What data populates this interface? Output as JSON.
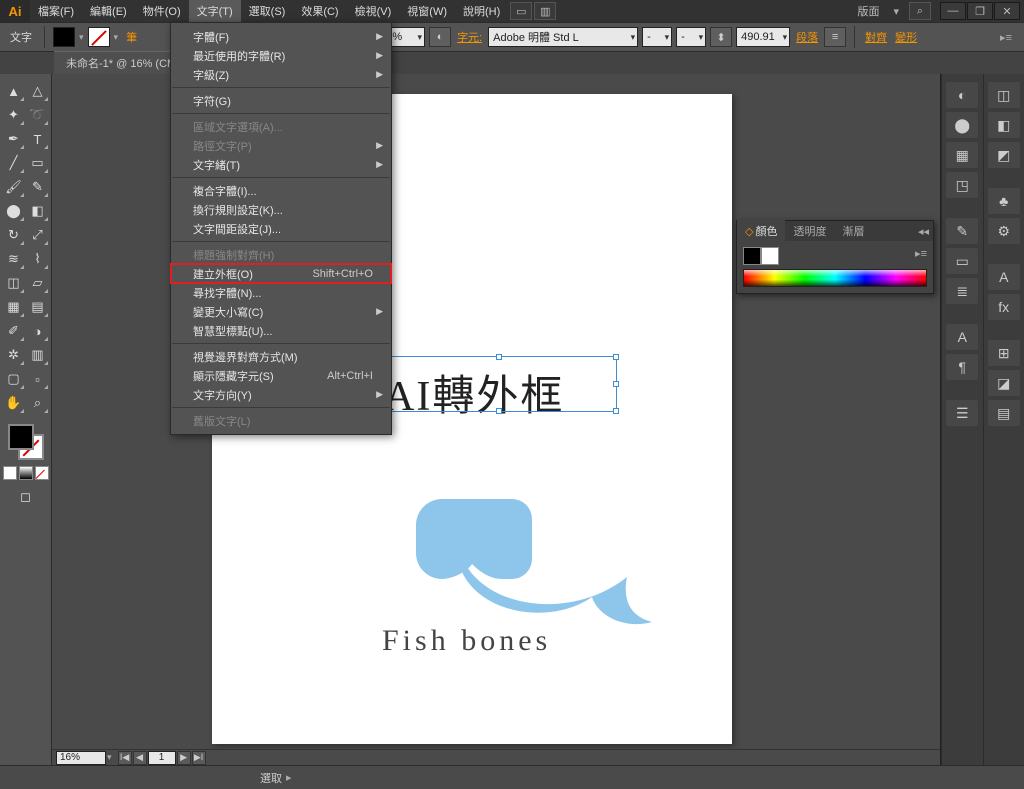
{
  "app": {
    "logo": "Ai"
  },
  "menubar": {
    "items": [
      {
        "label": "檔案(F)"
      },
      {
        "label": "編輯(E)"
      },
      {
        "label": "物件(O)"
      },
      {
        "label": "文字(T)",
        "active": true
      },
      {
        "label": "選取(S)"
      },
      {
        "label": "效果(C)"
      },
      {
        "label": "檢視(V)"
      },
      {
        "label": "視窗(W)"
      },
      {
        "label": "說明(H)"
      }
    ]
  },
  "titlebar_right": {
    "layout_label": "版面",
    "search_glyph": "⌕"
  },
  "window_buttons": {
    "min": "—",
    "max": "❐",
    "close": "✕"
  },
  "controlbar": {
    "left_label": "文字",
    "zoom": "100%",
    "char_label": "字元:",
    "font": "Adobe 明體 Std L",
    "style": "-",
    "size": "-",
    "width": "490.91",
    "para_label": "段落",
    "align": "對齊",
    "transform": "變形"
  },
  "doctab": {
    "title": "未命名-1* @ 16% (CM"
  },
  "type_menu": {
    "items": [
      {
        "label": "字體(F)",
        "submenu": true
      },
      {
        "label": "最近使用的字體(R)",
        "submenu": true
      },
      {
        "label": "字級(Z)",
        "submenu": true
      },
      {
        "sep": true
      },
      {
        "label": "字符(G)"
      },
      {
        "sep": true
      },
      {
        "label": "區域文字選項(A)...",
        "disabled": true
      },
      {
        "label": "路徑文字(P)",
        "submenu": true,
        "disabled": true
      },
      {
        "label": "文字緒(T)",
        "submenu": true
      },
      {
        "sep": true
      },
      {
        "label": "複合字體(I)..."
      },
      {
        "label": "換行規則設定(K)..."
      },
      {
        "label": "文字間距設定(J)..."
      },
      {
        "sep": true
      },
      {
        "label": "標題強制對齊(H)",
        "disabled": true
      },
      {
        "label": "建立外框(O)",
        "shortcut": "Shift+Ctrl+O",
        "highlight": true
      },
      {
        "label": "尋找字體(N)..."
      },
      {
        "label": "變更大小寫(C)",
        "submenu": true
      },
      {
        "label": "智慧型標點(U)..."
      },
      {
        "sep": true
      },
      {
        "label": "視覺邊界對齊方式(M)"
      },
      {
        "label": "顯示隱藏字元(S)",
        "shortcut": "Alt+Ctrl+I"
      },
      {
        "label": "文字方向(Y)",
        "submenu": true
      },
      {
        "sep": true
      },
      {
        "label": "舊版文字(L)",
        "disabled": true
      }
    ]
  },
  "canvas": {
    "selected_text": "AI轉外框",
    "logo_text": "Fish bones"
  },
  "scroll": {
    "zoom": "16%",
    "page": "1"
  },
  "status": {
    "mode": "選取"
  },
  "color_panel": {
    "tabs": [
      {
        "label": "顏色",
        "active": true,
        "dot": true
      },
      {
        "label": "透明度"
      },
      {
        "label": "漸層"
      }
    ]
  },
  "tools": {
    "rows": [
      [
        "selection",
        "direct-select"
      ],
      [
        "wand",
        "lasso"
      ],
      [
        "pen",
        "type"
      ],
      [
        "line",
        "rect"
      ],
      [
        "brush",
        "pencil"
      ],
      [
        "blob",
        "eraser"
      ],
      [
        "rotate",
        "scale"
      ],
      [
        "width",
        "warp"
      ],
      [
        "shape-builder",
        "perspective"
      ],
      [
        "mesh",
        "gradient"
      ],
      [
        "eyedrop",
        "blend"
      ],
      [
        "symbol",
        "graph"
      ],
      [
        "artboard",
        "slice"
      ],
      [
        "hand",
        "zoom"
      ]
    ],
    "glyphs": {
      "selection": "▲",
      "direct-select": "△",
      "wand": "✦",
      "lasso": "➰",
      "pen": "✒",
      "type": "T",
      "line": "╱",
      "rect": "▭",
      "brush": "🖌",
      "pencil": "✎",
      "blob": "⬤",
      "eraser": "◧",
      "rotate": "↻",
      "scale": "⤢",
      "width": "≋",
      "warp": "⌇",
      "shape-builder": "◫",
      "perspective": "▱",
      "mesh": "▦",
      "gradient": "▤",
      "eyedrop": "✐",
      "blend": "◑",
      "symbol": "✲",
      "graph": "▥",
      "artboard": "▢",
      "slice": "▫",
      "hand": "✋",
      "zoom": "⌕"
    }
  },
  "dock": {
    "col1": [
      "◐",
      "⬤",
      "▦",
      "◳",
      "—",
      "✎",
      "▭",
      "≣",
      "—",
      "A",
      "¶",
      "—",
      "☰"
    ],
    "col2": [
      "◫",
      "◧",
      "◩",
      "—",
      "♣",
      "⚙",
      "—",
      "A",
      "fx",
      "—",
      "⊞",
      "◪",
      "▤"
    ]
  }
}
